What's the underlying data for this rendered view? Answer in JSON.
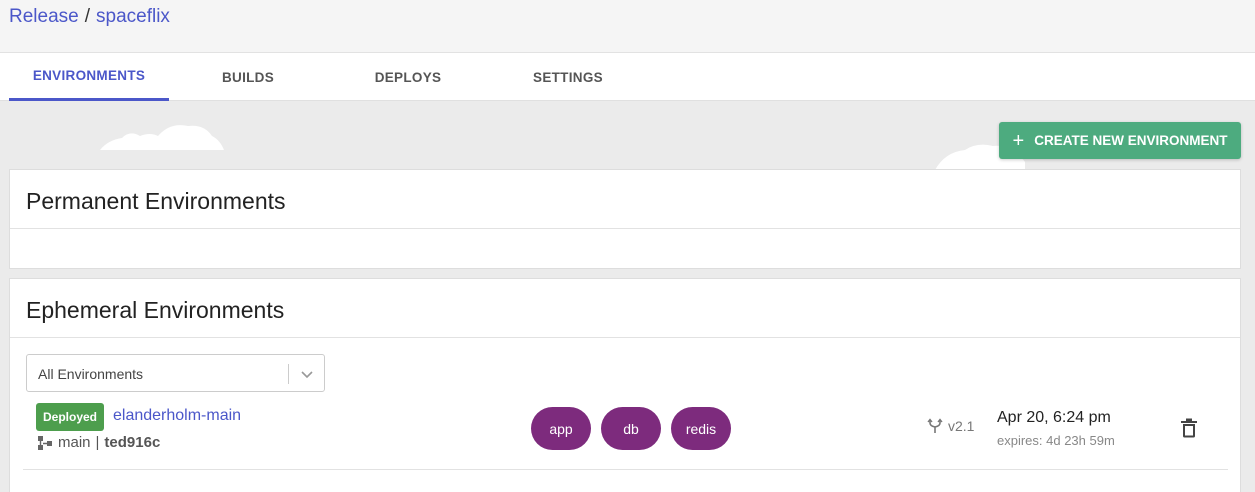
{
  "breadcrumb": {
    "org": "Release",
    "separator": "/",
    "app": "spaceflix"
  },
  "tabs": [
    {
      "label": "ENVIRONMENTS",
      "active": true
    },
    {
      "label": "BUILDS",
      "active": false
    },
    {
      "label": "DEPLOYS",
      "active": false
    },
    {
      "label": "SETTINGS",
      "active": false
    }
  ],
  "actions": {
    "create_label": "CREATE NEW ENVIRONMENT",
    "create_icon": "plus-icon"
  },
  "permanent": {
    "title": "Permanent Environments"
  },
  "ephemeral": {
    "title": "Ephemeral Environments",
    "filter": {
      "selected": "All Environments"
    },
    "environments": [
      {
        "status": "Deployed",
        "name": "elanderholm-main",
        "branch": "main",
        "separator": "|",
        "commit": "ted916c",
        "services": [
          "app",
          "db",
          "redis"
        ],
        "version": "v2.1",
        "date": "Apr 20, 6:24 pm",
        "expires": "expires: 4d 23h 59m"
      }
    ]
  },
  "colors": {
    "link": "#4b57c9",
    "create_button": "#4dab7f",
    "deployed_badge": "#4d9e4d",
    "service_pill": "#7d2b7d"
  }
}
